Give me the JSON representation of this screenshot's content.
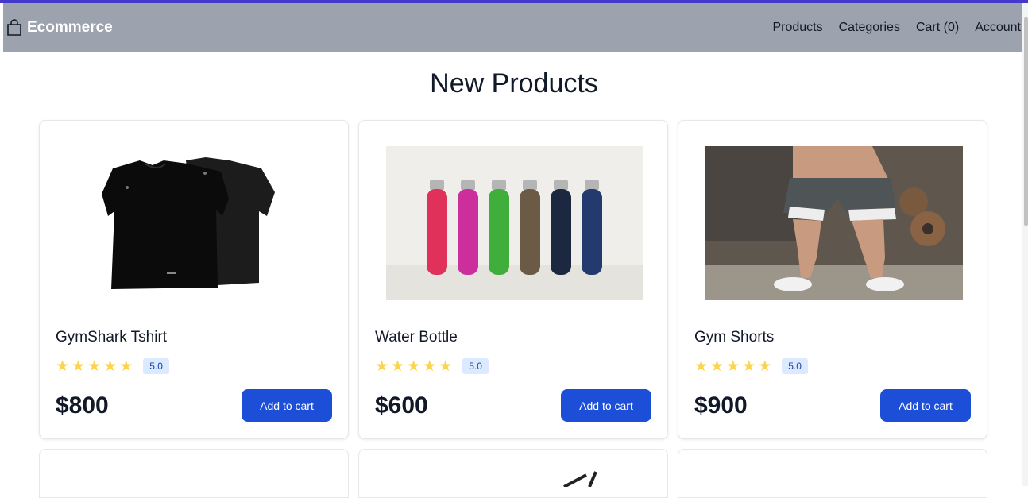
{
  "nav": {
    "brand": "Ecommerce",
    "links": [
      "Products",
      "Categories",
      "Cart (0)",
      "Account"
    ]
  },
  "main": {
    "title": "New Products",
    "products": [
      {
        "name": "GymShark Tshirt",
        "rating": "5.0",
        "price": "$800",
        "button": "Add to cart"
      },
      {
        "name": "Water Bottle",
        "rating": "5.0",
        "price": "$600",
        "button": "Add to cart"
      },
      {
        "name": "Gym Shorts",
        "rating": "5.0",
        "price": "$900",
        "button": "Add to cart"
      }
    ]
  },
  "colors": {
    "navbar": "#9ca3af",
    "accent": "#1d4ed8",
    "star": "#fcd34d",
    "topline": "#4338ca"
  },
  "icons": {
    "brand": "shopping-bag-icon",
    "rating": "star-icon"
  }
}
